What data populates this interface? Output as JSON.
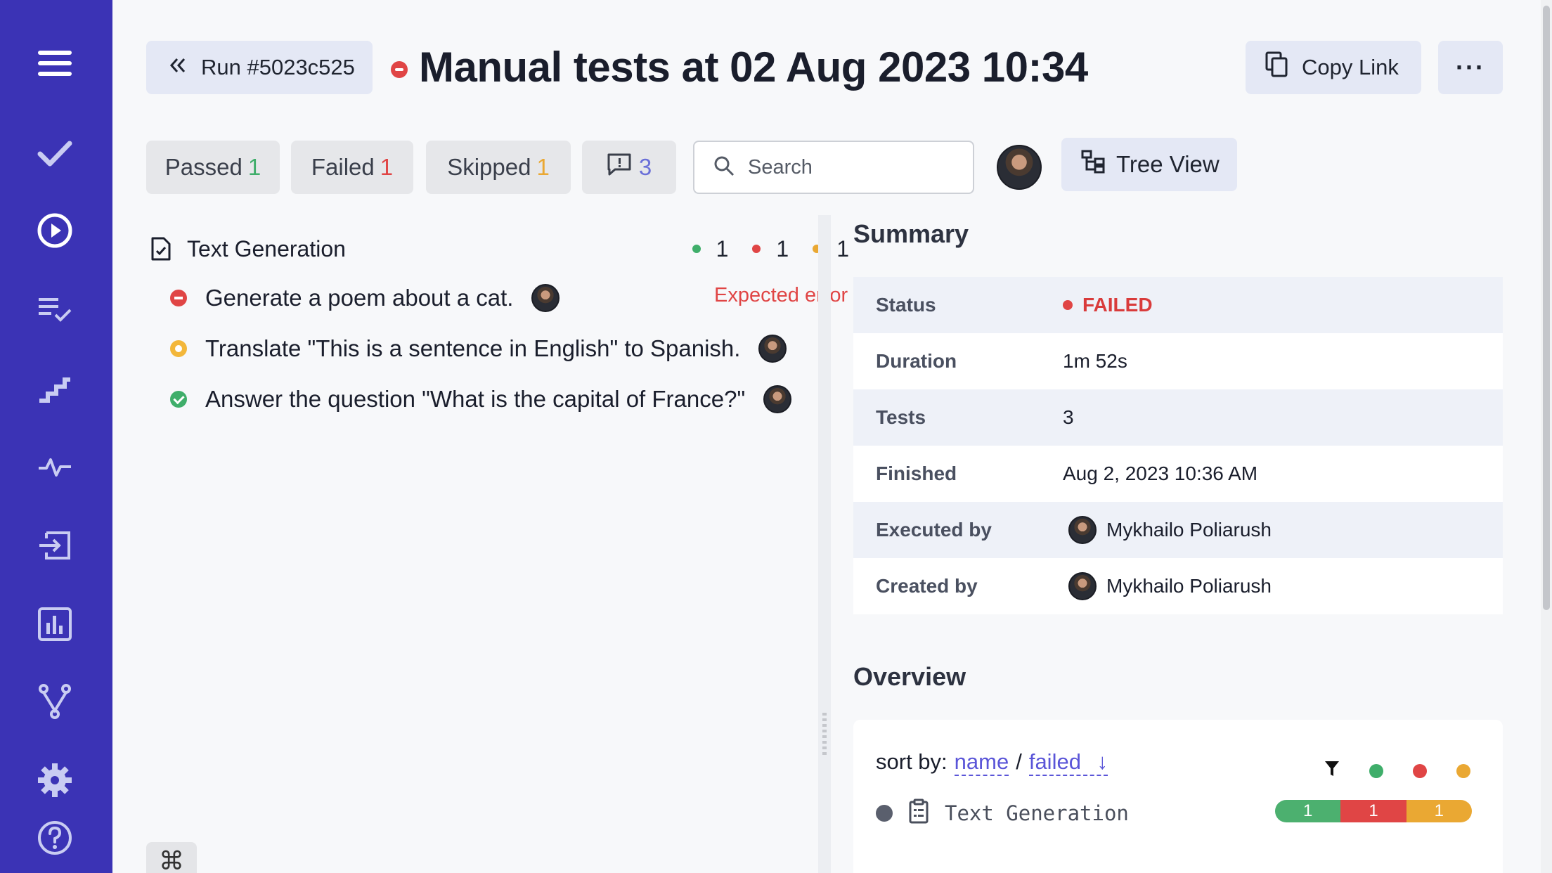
{
  "sidebar": {
    "icons": [
      "menu-icon",
      "check-icon",
      "play-circle-icon",
      "checklist-icon",
      "steps-icon",
      "pulse-icon",
      "import-icon",
      "chart-icon",
      "branch-icon",
      "gear-icon",
      "help-icon"
    ]
  },
  "header": {
    "run_label": "Run #5023c525",
    "title": "Manual tests at 02 Aug 2023 10:34",
    "copy_link_label": "Copy Link",
    "more_label": "···"
  },
  "filters": {
    "passed_label": "Passed",
    "passed_count": "1",
    "failed_label": "Failed",
    "failed_count": "1",
    "skipped_label": "Skipped",
    "skipped_count": "1",
    "comments_count": "3",
    "search_placeholder": "Search",
    "tree_view_label": "Tree View"
  },
  "tree": {
    "suite_title": "Text Generation",
    "counts": {
      "passed": "1",
      "failed": "1",
      "skipped": "1"
    },
    "tests": [
      {
        "title": "Generate a poem about a cat.",
        "status": "failed"
      },
      {
        "title": "Translate \"This is a sentence in English\" to Spanish.",
        "status": "skipped"
      },
      {
        "title": "Answer the question \"What is the capital of France?\"",
        "status": "passed"
      }
    ],
    "expected_error_label": "Expected error",
    "cmd_label": "⌘"
  },
  "summary": {
    "heading": "Summary",
    "rows": [
      {
        "key": "Status",
        "value": "FAILED"
      },
      {
        "key": "Duration",
        "value": "1m 52s"
      },
      {
        "key": "Tests",
        "value": "3"
      },
      {
        "key": "Finished",
        "value": "Aug 2, 2023 10:36 AM"
      },
      {
        "key": "Executed by",
        "value": "Mykhailo Poliarush"
      },
      {
        "key": "Created by",
        "value": "Mykhailo Poliarush"
      }
    ]
  },
  "overview": {
    "heading": "Overview",
    "sort_prefix": "sort by:",
    "sort_name": "name",
    "sort_sep": "/",
    "sort_failed": "failed",
    "sort_arrow": "↓",
    "suite_name": "Text Generation",
    "bar": {
      "passed": "1",
      "failed": "1",
      "skipped": "1"
    }
  },
  "colors": {
    "sidebar": "#3b33b5",
    "passed": "#3fae6a",
    "failed": "#e04545",
    "skipped": "#eaa833",
    "accent": "#5a55d8"
  }
}
